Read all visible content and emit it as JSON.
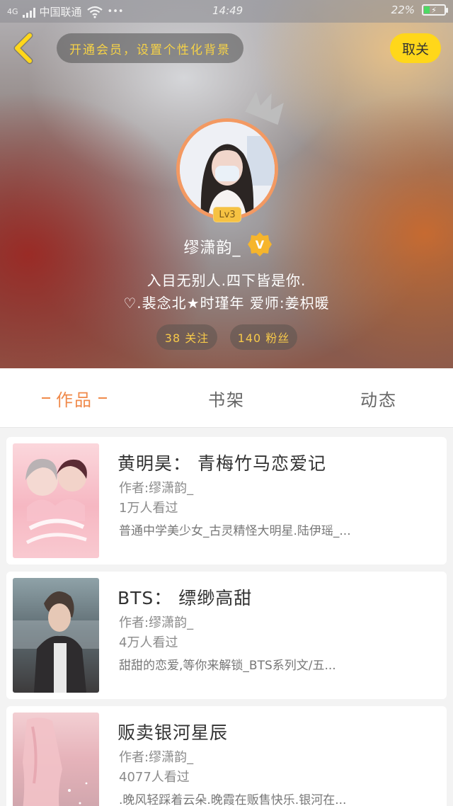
{
  "status_bar": {
    "network": "4G",
    "carrier": "中国联通",
    "dots": "•••",
    "time": "14:49",
    "battery": "22%"
  },
  "header": {
    "vip_prompt": "开通会员，设置个性化背景",
    "cancel_label": "取关"
  },
  "profile": {
    "level": "Lv3",
    "username": "缪潇韵_",
    "verified_badge": "V",
    "bio_line1": "入目无别人.四下皆是你.",
    "bio_line2": "♡.裴念北★时瑾年 爱师:姜枳暖",
    "following": "38 关注",
    "fans": "140 粉丝"
  },
  "tabs": [
    {
      "label": "作品",
      "active": true
    },
    {
      "label": "书架",
      "active": false
    },
    {
      "label": "动态",
      "active": false
    }
  ],
  "books": [
    {
      "title": "黄明昊： 青梅竹马恋爱记",
      "author": "作者:缪潇韵_",
      "views": "1万人看过",
      "desc": "普通中学美少女_古灵精怪大明星.陆伊瑶_..."
    },
    {
      "title": "BTS： 缥缈高甜",
      "author": "作者:缪潇韵_",
      "views": "4万人看过",
      "desc": "甜甜的恋爱,等你来解锁_BTS系列文/五..."
    },
    {
      "title": "贩卖银河星辰",
      "author": "作者:缪潇韵_",
      "views": "4077人看过",
      "desc": ".晚风轻踩着云朵.晚霞在贩售快乐.银河在..."
    }
  ],
  "colors": {
    "accent_orange": "#f08a4b",
    "vip_yellow": "#ffd71a",
    "badge_gold": "#f6c242"
  }
}
